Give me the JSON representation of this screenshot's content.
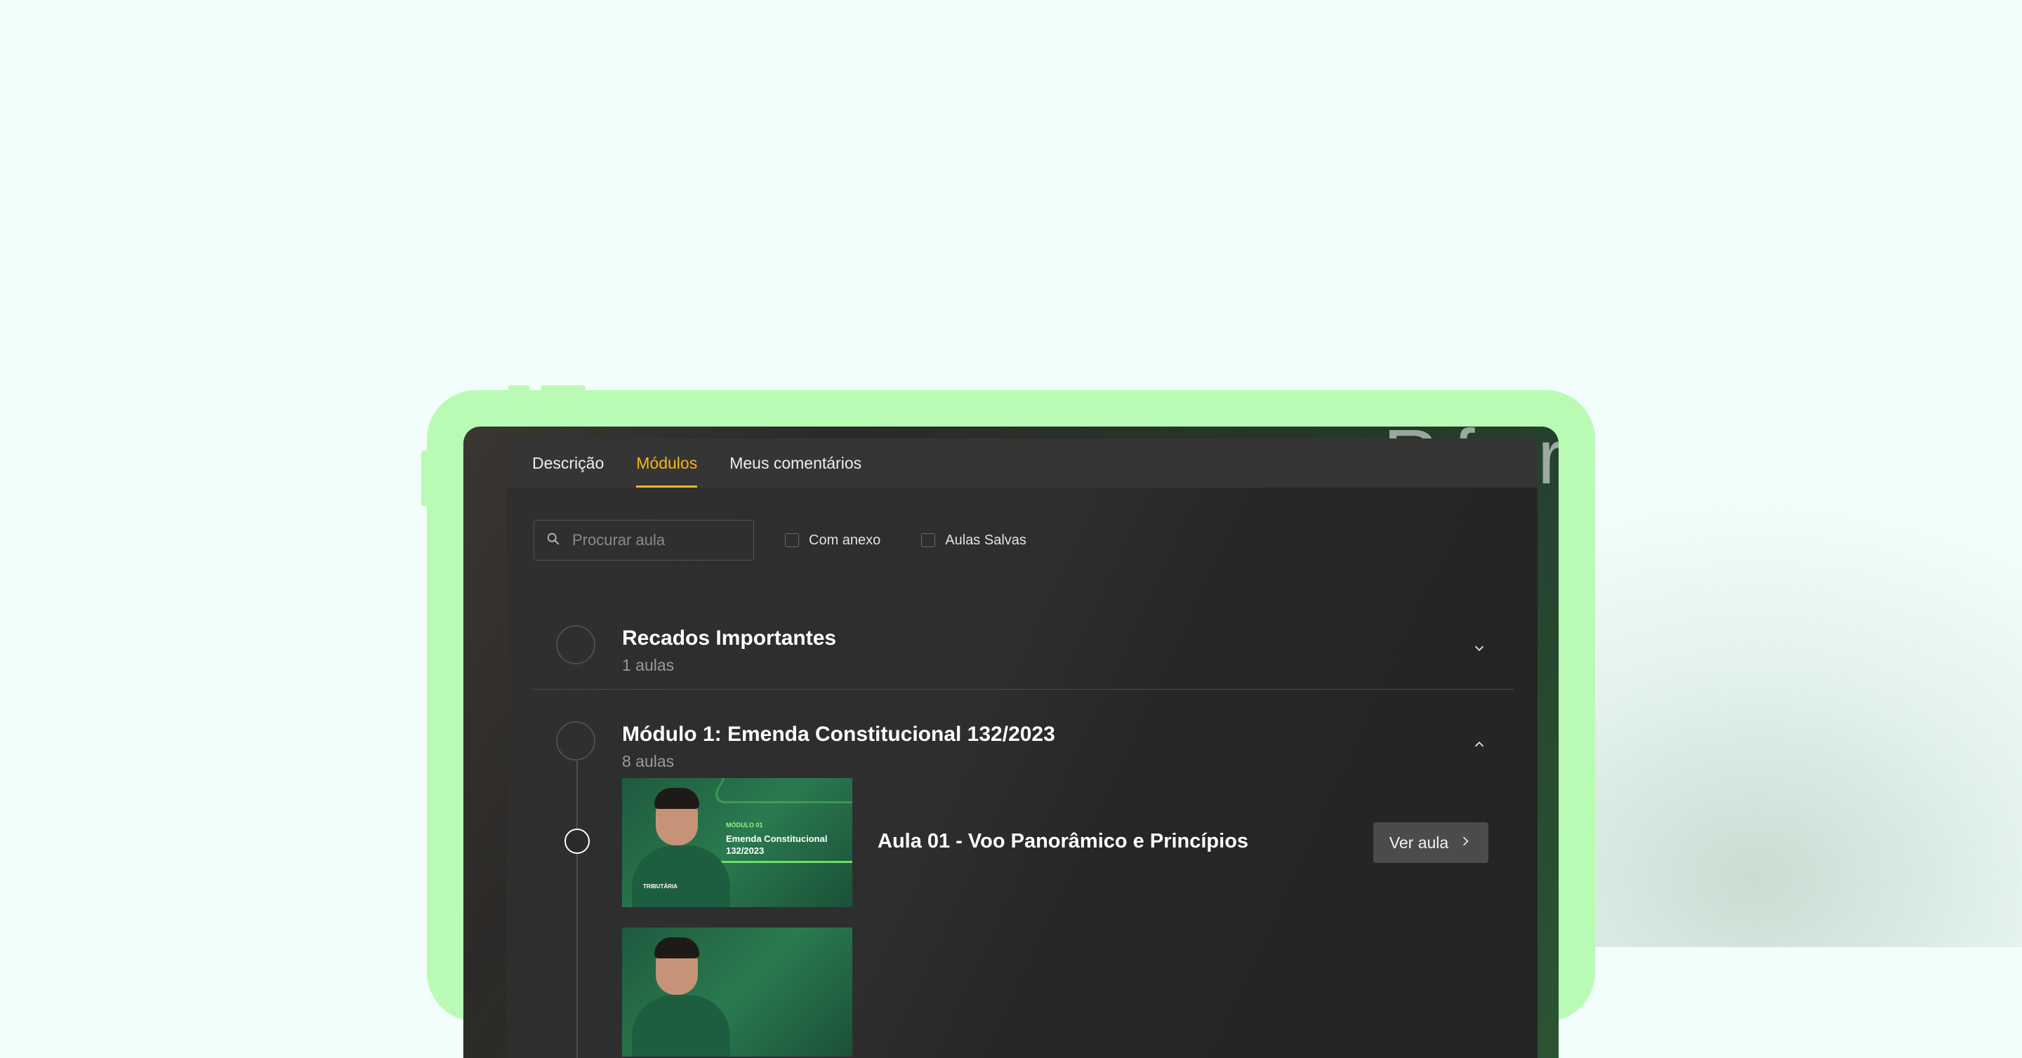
{
  "tabs": [
    {
      "label": "Descrição",
      "active": false
    },
    {
      "label": "Módulos",
      "active": true
    },
    {
      "label": "Meus comentários",
      "active": false
    }
  ],
  "filters": {
    "search_placeholder": "Procurar aula",
    "with_attachment_label": "Com anexo",
    "saved_lessons_label": "Aulas Salvas"
  },
  "modules": [
    {
      "title": "Recados Importantes",
      "subtitle": "1 aulas",
      "expanded": false
    },
    {
      "title": "Módulo 1: Emenda Constitucional 132/2023",
      "subtitle": "8 aulas",
      "expanded": true,
      "lessons": [
        {
          "title": "Aula 01 - Voo Panorâmico e Princípios",
          "button_label": "Ver aula",
          "thumbnail": {
            "tag": "MÓDULO 01",
            "line1": "Emenda Constitucional",
            "line2": "132/2023",
            "brand": "TRIBUTÁRIA"
          }
        }
      ]
    }
  ],
  "colors": {
    "accent": "#f5b719",
    "device_frame": "#b9fbb5",
    "thumbnail_highlight": "#69e06a"
  },
  "icons": [
    "search-icon",
    "chevron-down-icon",
    "chevron-up-icon",
    "chevron-right-icon"
  ]
}
